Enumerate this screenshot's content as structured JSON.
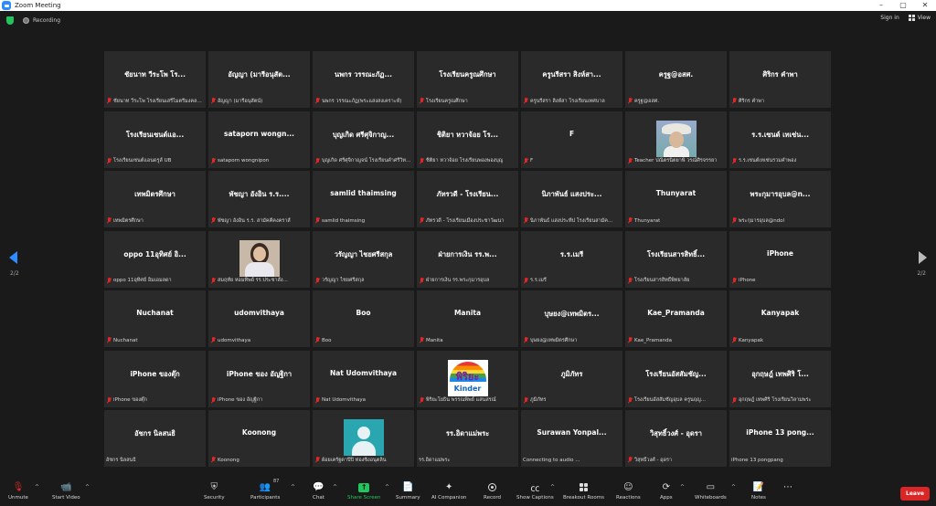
{
  "window": {
    "title": "Zoom Meeting",
    "controls": [
      "–",
      "▢",
      "✕"
    ]
  },
  "topbar": {
    "recording_label": "Recording",
    "sign_in": "Sign in",
    "view": "View"
  },
  "colors": {
    "accent": "#2d8cff",
    "share_green": "#22c55e",
    "leave_red": "#d92727",
    "mic_off_red": "#e02828"
  },
  "pagination": {
    "left": "2/2",
    "right": "2/2"
  },
  "tiles": [
    {
      "name": "ชัยนาท วีระโพ โร...",
      "label": "ชัยนาท วีระโพ โรงเรียนเสรีไมตรีมงคลส..."
    },
    {
      "name": "อัญญา (มารีอนุสัต...",
      "label": "อัญญา (มารีอนุสัตน์)"
    },
    {
      "name": "นพกร วรรณะภัฏ...",
      "label": "นพกร วรรณะภัฏ(พระแสงสงเคราะห์)"
    },
    {
      "name": "โรงเรียนครูณศึกษา",
      "label": "โรงเรียนครูณศึกษา"
    },
    {
      "name": "ครูนรีสรา สิงห์สา...",
      "label": "ครูนรีสรา สิงห์สา โรงเรียนเทศบาล"
    },
    {
      "name": "ครูฐ@อสศ.",
      "label": "ครูฐ@อสศ."
    },
    {
      "name": "ศิริกร คำพา",
      "label": "ศิริกร คำพา"
    },
    {
      "name": "โรงเรียนเซนต์แอ...",
      "label": "โรงเรียนเซนต์แอนดรูส์ UB"
    },
    {
      "name": "sataporn wongn...",
      "label": "sataporn wongnipon"
    },
    {
      "name": "บุญเกิด ศรีศุจิกาญ...",
      "label": "บุญเกิด ศรีศุจิกาญจน์ โรงเรียนคำศรีวิท..."
    },
    {
      "name": "ชิติยา หวาจ้อย โร...",
      "label": "ชิติยา หวาจ้อย โรงเรียนพองพองบุญ"
    },
    {
      "name": "F",
      "label": "F"
    },
    {
      "name": "",
      "label": "Teacher ปณิตรนิตยาพิ วรณ์ศิรจรรยา",
      "picture": "teacher"
    },
    {
      "name": "ร.ร.เซนต์ เทเซ่น...",
      "label": "ร.ร.เซนต์เทเซ่นรวมคำพอง"
    },
    {
      "name": "เทพมิตรศึกษา",
      "label": "เทพมิตรศึกษา"
    },
    {
      "name": "พัชญา อังอิน ร.ร....",
      "label": "พัชญา อังอิน ร.ร. สามัคคีคงคราส์"
    },
    {
      "name": "samlid thaimsing",
      "label": "samlid thaimsing"
    },
    {
      "name": "ภัทรวดี - โรงเรียน...",
      "label": "ภัทรวดี - โรงเรียนเมืองประชาวัฒนา"
    },
    {
      "name": "นิภาพันธ์ แสงประ...",
      "label": "นิภาพันธ์ แสงประทีป โรงเรียนสามัค..."
    },
    {
      "name": "Thunyarat",
      "label": "Thunyarat"
    },
    {
      "name": "พระกุมารอุบล@n...",
      "label": "พระกุมารอุบล@ndol"
    },
    {
      "name": "oppo 11อุทิศย์ อิ...",
      "label": "oppo 11อุทิศย์ อิ่มเอมลดา"
    },
    {
      "name": "",
      "label": "สมฤทัย หอมทิพย์ รร.ประชาสัง...",
      "picture": "woman"
    },
    {
      "name": "วรัญญา ไชยศรีสกุล",
      "label": "วรัญญา ไชยศรีสกุล"
    },
    {
      "name": "ฝ่ายการเงิน รร.พ...",
      "label": "ฝ่ายการเงิน รร.พระกุมารอุบล"
    },
    {
      "name": "ร.ร.เมรี",
      "label": "ร.ร.เมรี"
    },
    {
      "name": "โรงเรียนสารสิทธิ์...",
      "label": "โรงเรียนสารสิทธิ์พิทยาลัย"
    },
    {
      "name": "iPhone",
      "label": "iPhone"
    },
    {
      "name": "Nuchanat",
      "label": "Nuchanat"
    },
    {
      "name": "udomvithaya",
      "label": "udomvithaya"
    },
    {
      "name": "Boo",
      "label": "Boo"
    },
    {
      "name": "Manita",
      "label": "Manita"
    },
    {
      "name": "บุษยง@เทพมิตร...",
      "label": "บุษยง@เทพมิตรศึกษา"
    },
    {
      "name": "Kae_Pramanda",
      "label": "Kae_Pramanda"
    },
    {
      "name": "Kanyapak",
      "label": "Kanyapak"
    },
    {
      "name": "iPhone ของตุ๊ก",
      "label": "iPhone ของตุ๊ก"
    },
    {
      "name": "iPhone ของ อัญฐิกา",
      "label": "iPhone ของ อัญฐิกา"
    },
    {
      "name": "Nat Udomvithaya",
      "label": "Nat Udomvithaya"
    },
    {
      "name": "",
      "label": "พิริยะโยธิน พรรณพิพย์ แสนสรณ์",
      "picture": "logo",
      "logo_text": "พิริยะ",
      "logo_sub": "Kinder"
    },
    {
      "name": "ภูมิภัทร",
      "label": "ภูมิภัทร"
    },
    {
      "name": "โรงเรียนอัสสัมชัญ...",
      "label": "โรงเรียนอัสสัมชัญอุบล ครูนฤญ..."
    },
    {
      "name": "อุกฤษฎ์ เทพศิริ โ...",
      "label": "อุกฤษฎ์ เทพศิริ โรงเรียนวิลามพระ"
    },
    {
      "name": "อัชกร นิลสนธิ",
      "label": "อัชกร นิลสนธิ",
      "no_mic": true
    },
    {
      "name": "Koonong",
      "label": "Koonong"
    },
    {
      "name": "",
      "label": "ผ้อยเครัฐตาปีปิ ท่องซิงอนุตลิน",
      "picture": "avatar"
    },
    {
      "name": "รร.อิดาแม่พระ",
      "label": "รร.อิดาแม่พระ",
      "no_mic": true
    },
    {
      "name": "Surawan Yonpal...",
      "label": "Connecting to audio ...",
      "no_mic": true
    },
    {
      "name": "วิสุทธิ์วงศ์ - อุดรา",
      "label": "วิสุทธิ์วงศ์ - อุดรา"
    },
    {
      "name": "iPhone 13 pong...",
      "label": "iPhone 13 pongpang",
      "no_mic": true
    }
  ],
  "toolbar": {
    "unmute": "Unmute",
    "start_video": "Start Video",
    "security": "Security",
    "participants": "Participants",
    "participants_count": "87",
    "chat": "Chat",
    "share_screen": "Share Screen",
    "summary": "Summary",
    "ai_companion": "AI Companion",
    "record": "Record",
    "show_captions": "Show Captions",
    "breakout_rooms": "Breakout Rooms",
    "reactions": "Reactions",
    "apps": "Apps",
    "whiteboards": "Whiteboards",
    "notes": "Notes",
    "leave": "Leave"
  }
}
